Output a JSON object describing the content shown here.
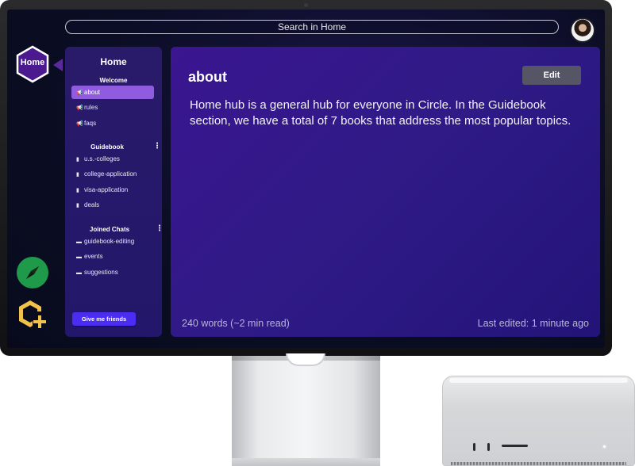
{
  "search": {
    "placeholder": "Search in Home"
  },
  "rail": {
    "home_label": "Home",
    "explore_icon": "compass-icon",
    "add_icon": "add-hub-icon"
  },
  "sidebar": {
    "title": "Home",
    "sections": [
      {
        "heading": "Welcome",
        "items": [
          {
            "label": "about",
            "icon": "megaphone-icon",
            "active": true
          },
          {
            "label": "rules",
            "icon": "megaphone-icon"
          },
          {
            "label": "faqs",
            "icon": "megaphone-icon"
          }
        ]
      },
      {
        "heading": "Guidebook",
        "items": [
          {
            "label": "u.s.-colleges",
            "icon": "document-icon"
          },
          {
            "label": "college-application",
            "icon": "document-icon"
          },
          {
            "label": "visa-application",
            "icon": "document-icon"
          },
          {
            "label": "deals",
            "icon": "document-icon"
          }
        ]
      },
      {
        "heading": "Joined Chats",
        "items": [
          {
            "label": "guidebook-editing",
            "icon": "chat-icon"
          },
          {
            "label": "events",
            "icon": "chat-icon"
          },
          {
            "label": "suggestions",
            "icon": "chat-icon"
          }
        ]
      }
    ],
    "cta_label": "Give me friends"
  },
  "main": {
    "title": "about",
    "edit_label": "Edit",
    "body": "Home hub is a general hub for everyone in Circle. In the Guidebook section, we have a total of 7 books that address the most popular topics.",
    "word_count": "240 words (~2 min read)",
    "last_edited": "Last edited: 1 minute ago"
  },
  "colors": {
    "accent": "#8f5ce0",
    "cta": "#4a2df0",
    "explore_green": "#1f9a4a",
    "add_yellow": "#f2c14a"
  }
}
